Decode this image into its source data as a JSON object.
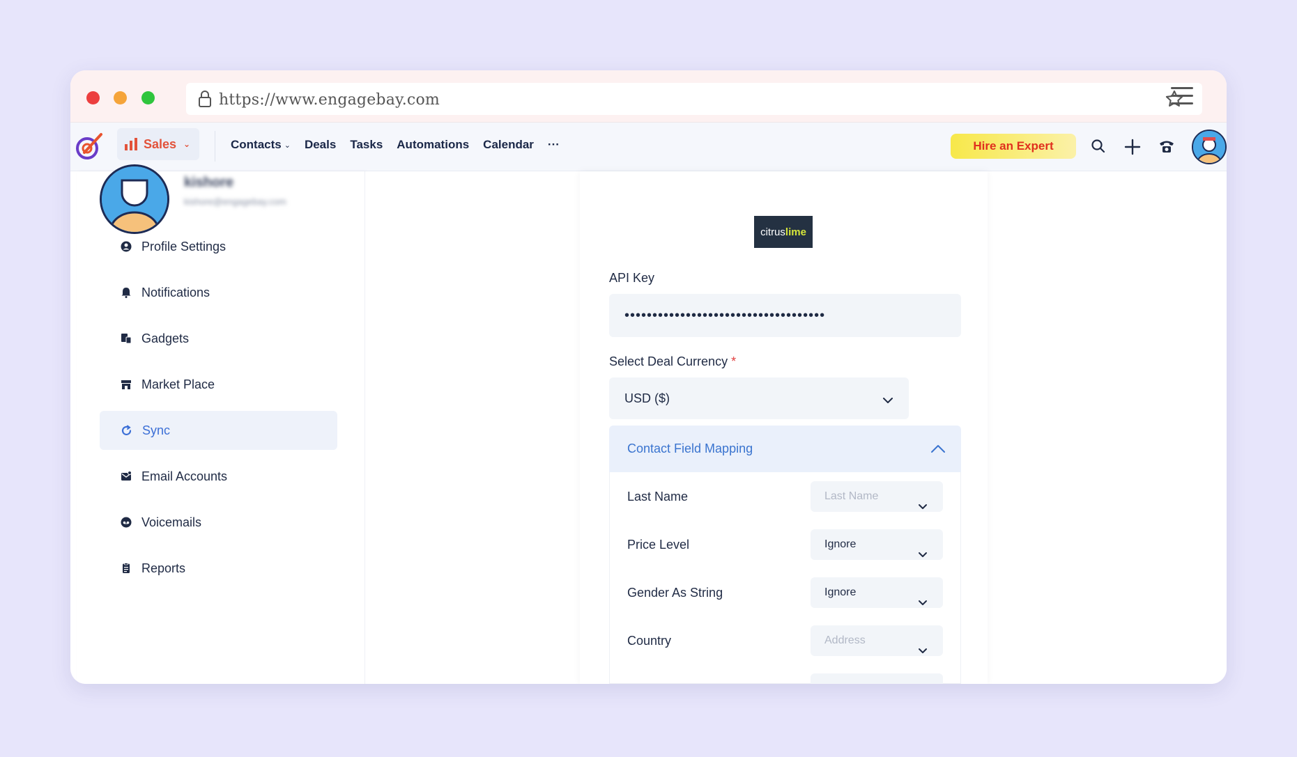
{
  "browser": {
    "url": "https://www.engagebay.com"
  },
  "nav": {
    "module": "Sales",
    "links": [
      {
        "label": "Contacts",
        "has_dropdown": true
      },
      {
        "label": "Deals"
      },
      {
        "label": "Tasks"
      },
      {
        "label": "Automations"
      },
      {
        "label": "Calendar"
      }
    ],
    "more": "···",
    "hire_expert": "Hire an Expert",
    "icons": [
      "search-icon",
      "plus-icon",
      "phone-icon",
      "user-avatar"
    ]
  },
  "sidebar": {
    "user_name": "kishore",
    "user_email": "kishore@engagebay.com",
    "items": [
      {
        "label": "Profile Settings",
        "icon": "user-circle-icon"
      },
      {
        "label": "Notifications",
        "icon": "bell-icon"
      },
      {
        "label": "Gadgets",
        "icon": "gadgets-icon"
      },
      {
        "label": "Market Place",
        "icon": "store-icon"
      },
      {
        "label": "Sync",
        "icon": "sync-icon",
        "active": true
      },
      {
        "label": "Email Accounts",
        "icon": "mail-icon"
      },
      {
        "label": "Voicemails",
        "icon": "voicemail-icon"
      },
      {
        "label": "Reports",
        "icon": "report-icon"
      }
    ]
  },
  "integration": {
    "brand_part1": "citrus",
    "brand_part2": "lime",
    "api_key_label": "API Key",
    "api_key_value": "••••••••••••••••••••••••••••••••••••",
    "currency_label": "Select Deal Currency",
    "required_mark": "*",
    "currency_value": "USD ($)",
    "mapping_title": "Contact Field Mapping",
    "mapping_rows": [
      {
        "label": "Last Name",
        "value": "Last Name",
        "placeholder": true
      },
      {
        "label": "Price Level",
        "value": "Ignore",
        "placeholder": false
      },
      {
        "label": "Gender As String",
        "value": "Ignore",
        "placeholder": false
      },
      {
        "label": "Country",
        "value": "Address",
        "placeholder": true
      }
    ]
  },
  "colors": {
    "background": "#e7e5fb",
    "accent": "#3a74cf",
    "sales": "#e2523a",
    "hire": "#f7e84a"
  }
}
